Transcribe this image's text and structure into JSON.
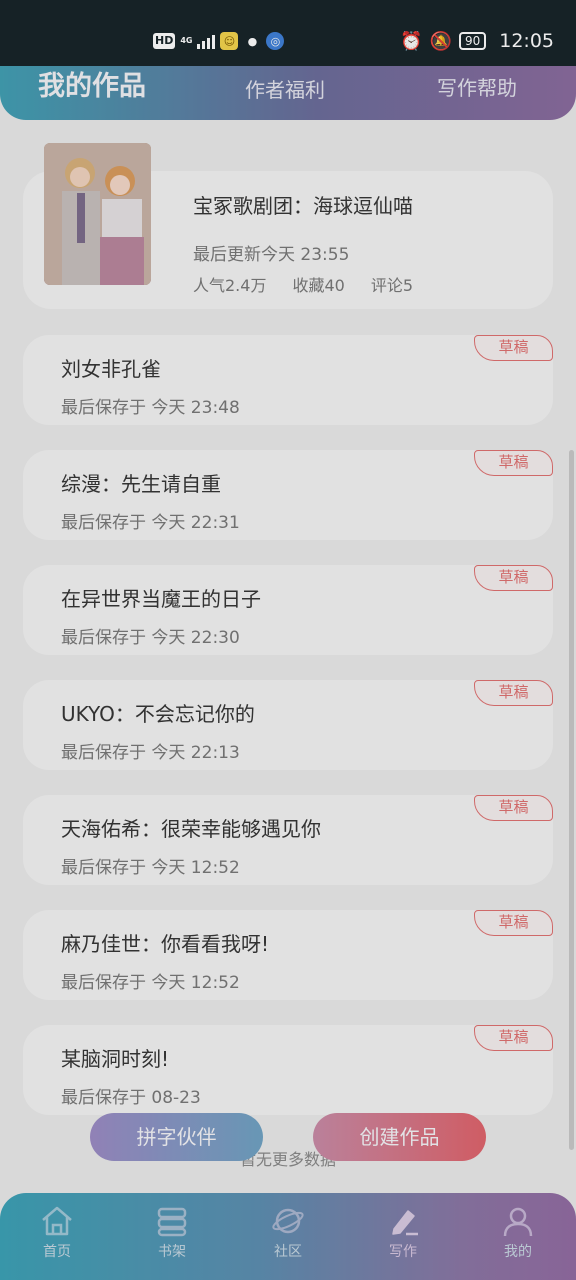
{
  "status_bar": {
    "hd": "HD",
    "network": "4G",
    "battery": "90",
    "time": "12:05"
  },
  "header": {
    "tabs": [
      "我的作品",
      "作者福利",
      "写作帮助"
    ],
    "gradient": [
      "#3f9fb3",
      "#8a6a9e"
    ]
  },
  "published": {
    "title": "宝冢歌剧团：海球逗仙喵",
    "updated": "最后更新今天 23:55",
    "popularity": "人气2.4万",
    "favorites": "收藏40",
    "comments": "评论5"
  },
  "drafts": [
    {
      "title": "刘女非孔雀",
      "saved": "最后保存于 今天 23:48",
      "badge": "草稿"
    },
    {
      "title": "综漫：先生请自重",
      "saved": "最后保存于 今天 22:31",
      "badge": "草稿"
    },
    {
      "title": "在异世界当魔王的日子",
      "saved": "最后保存于 今天 22:30",
      "badge": "草稿"
    },
    {
      "title": "UKYO：不会忘记你的",
      "saved": "最后保存于 今天 22:13",
      "badge": "草稿"
    },
    {
      "title": "天海佑希：很荣幸能够遇见你",
      "saved": "最后保存于 今天 12:52",
      "badge": "草稿"
    },
    {
      "title": "麻乃佳世：你看看我呀!",
      "saved": "最后保存于 今天 12:52",
      "badge": "草稿"
    },
    {
      "title": "某脑洞时刻!",
      "saved": "最后保存于 08-23",
      "badge": "草稿"
    }
  ],
  "footer": {
    "no_more": "暂无更多数据",
    "partner_button": "拼字伙伴",
    "create_button": "创建作品"
  },
  "tabbar": {
    "items": [
      {
        "label": "首页",
        "icon": "home-icon"
      },
      {
        "label": "书架",
        "icon": "bookshelf-icon"
      },
      {
        "label": "社区",
        "icon": "planet-icon"
      },
      {
        "label": "写作",
        "icon": "pen-icon"
      },
      {
        "label": "我的",
        "icon": "user-icon"
      }
    ]
  },
  "colors": {
    "accent_teal": "#3aa1b6",
    "accent_purple": "#926aa2",
    "draft_badge": "#e07070",
    "create_button": "#e0626a"
  }
}
